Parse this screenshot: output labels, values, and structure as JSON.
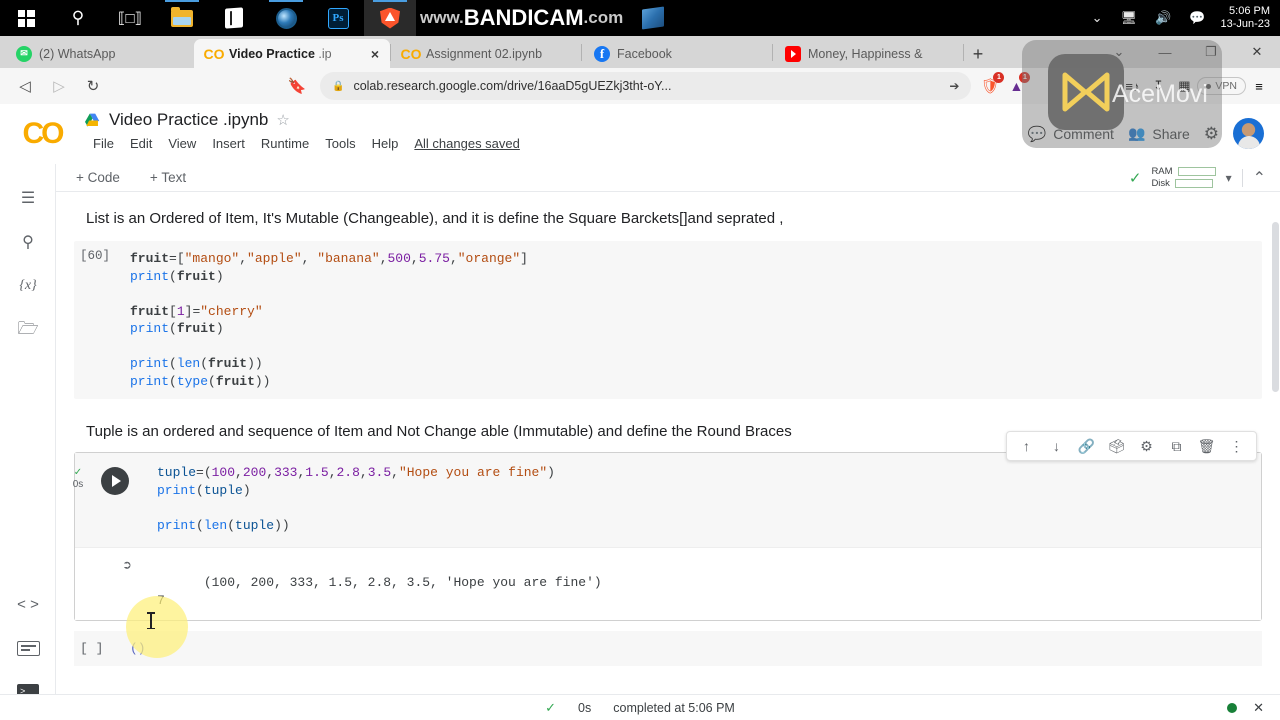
{
  "taskbar": {
    "items": [
      {
        "name": "start-button",
        "icon": "windows-logo-icon"
      },
      {
        "name": "search-button",
        "icon": "search-icon"
      },
      {
        "name": "task-view-button",
        "icon": "task-view-icon"
      },
      {
        "name": "file-explorer-button",
        "icon": "folder-icon"
      },
      {
        "name": "microsoft-store-button",
        "icon": "store-icon"
      },
      {
        "name": "photos-button",
        "icon": "photos-icon"
      },
      {
        "name": "photoshop-button",
        "icon": "photoshop-icon",
        "label": "Ps"
      },
      {
        "name": "brave-browser-button",
        "icon": "brave-icon"
      }
    ],
    "bandicam": {
      "prefix": "www.",
      "bold": "BANDICAM",
      "suffix": ".com"
    },
    "word_button": "word-icon",
    "tray": {
      "chevron": "chevron-up-icon",
      "network": "network-icon",
      "volume": "volume-icon",
      "notifications": "notification-icon",
      "time": "5:06 PM",
      "date": "13-Jun-23"
    }
  },
  "browser": {
    "tabs": [
      {
        "label": "(2) WhatsApp",
        "favicon": "whatsapp-icon",
        "active": false
      },
      {
        "label": "Video Practice .ip",
        "label_main": "Video Practice ",
        "label_dim": ".ip",
        "favicon": "colab-icon",
        "active": true,
        "close": "×"
      },
      {
        "label": "Assignment 02.ipynb",
        "favicon": "colab-icon",
        "active": false
      },
      {
        "label": "Facebook",
        "favicon": "facebook-icon",
        "active": false
      },
      {
        "label": "Money, Happiness &",
        "favicon": "youtube-icon",
        "active": false
      }
    ],
    "new_tab": "+",
    "window_controls": {
      "chevron": "⌄",
      "minimize": "—",
      "maximize": "❐",
      "close": "✕"
    },
    "nav": {
      "back": "◁",
      "forward": "▷",
      "reload": "↻",
      "bookmark": "☐"
    },
    "omnibox": {
      "lock": "🔒",
      "url": "colab.research.google.com/drive/16aaD5gUEZkj3tht-oY...",
      "share": "share-icon"
    },
    "extensions": [
      {
        "name": "brave-shields-icon",
        "badge": "1"
      },
      {
        "name": "brave-rewards-icon",
        "badge": "1"
      }
    ],
    "right_icons": [
      {
        "name": "playlist-icon"
      },
      {
        "name": "downloads-icon"
      },
      {
        "name": "brave-wallet-icon"
      },
      {
        "name": "leo-ai-icon"
      }
    ],
    "vpn_label": "VPN",
    "menu": "≡"
  },
  "colab": {
    "logo": "CO",
    "doc_title": "Video Practice .ipynb",
    "star": "☆",
    "menu_items": [
      "File",
      "Edit",
      "View",
      "Insert",
      "Runtime",
      "Tools",
      "Help"
    ],
    "saved_note": "All changes saved",
    "comment_label": "Comment",
    "share_label": "Share",
    "settings_icon": "gear-icon",
    "avatar": "user-avatar"
  },
  "toolbar": {
    "add_code": "+ Code",
    "add_text": "+ Text",
    "connected_check": "✓",
    "ram_label": "RAM",
    "disk_label": "Disk",
    "dropdown": "▾",
    "collapse": "⌃"
  },
  "sidebar": {
    "top_items": [
      {
        "name": "table-of-contents-icon",
        "glyph": "☰"
      },
      {
        "name": "search-icon",
        "glyph": "🔍"
      },
      {
        "name": "variables-icon",
        "glyph": "{x}"
      },
      {
        "name": "files-icon",
        "glyph": "🗀"
      }
    ],
    "bottom_items": [
      {
        "name": "code-snippets-icon",
        "glyph": "< >"
      },
      {
        "name": "command-palette-icon",
        "glyph": "cmd"
      },
      {
        "name": "terminal-icon",
        "glyph": ">_"
      }
    ]
  },
  "notebook": {
    "md_cell_1": "List is an Ordered of Item, It's Mutable (Changeable), and it is define the Square Barckets[]and seprated ,",
    "cell1": {
      "execution_count": "[60]",
      "lines": [
        "fruit=[\"mango\",\"apple\", \"banana\",500,5.75,\"orange\"]",
        "print(fruit)",
        "",
        "fruit[1]=\"cherry\"",
        "print(fruit)",
        "",
        "print(len(fruit))",
        "print(type(fruit))"
      ]
    },
    "md_cell_2": "Tuple is an ordered and sequence of Item and Not Change able (Immutable) and define the Round Braces",
    "cell2": {
      "status_check": "✓",
      "status_time": "0s",
      "run_button": "run-cell-button",
      "lines": [
        "tuple=(100,200,333,1.5,2.8,3.5,\"Hope you are fine\")",
        "print(tuple)",
        "",
        "print(len(tuple))"
      ],
      "output": [
        "(100, 200, 333, 1.5, 2.8, 3.5, 'Hope you are fine')",
        "7"
      ],
      "toolbar_icons": [
        {
          "name": "move-cell-up-icon",
          "glyph": "↑"
        },
        {
          "name": "move-cell-down-icon",
          "glyph": "↓"
        },
        {
          "name": "link-to-cell-icon",
          "glyph": "🔗"
        },
        {
          "name": "add-comment-icon",
          "glyph": "▤"
        },
        {
          "name": "cell-settings-icon",
          "glyph": "⚙"
        },
        {
          "name": "mirror-cell-icon",
          "glyph": "⧉"
        },
        {
          "name": "delete-cell-icon",
          "glyph": "🗑"
        },
        {
          "name": "more-options-icon",
          "glyph": "⋮"
        }
      ]
    },
    "cell3": {
      "execution_count": "[ ]",
      "code": "()"
    }
  },
  "statusbar": {
    "check": "✓",
    "elapsed": "0s",
    "message": "completed at 5:06 PM",
    "dot": "connected-indicator",
    "close": "✕"
  },
  "watermark": {
    "text": "AceMovi",
    "logo": "acemovi-logo-icon"
  },
  "colors": {
    "colab_orange": "#f9ab00",
    "accent_blue": "#1a73e8",
    "status_green": "#188038",
    "string_orange": "#b34d12",
    "number_purple": "#7b1fa2"
  }
}
